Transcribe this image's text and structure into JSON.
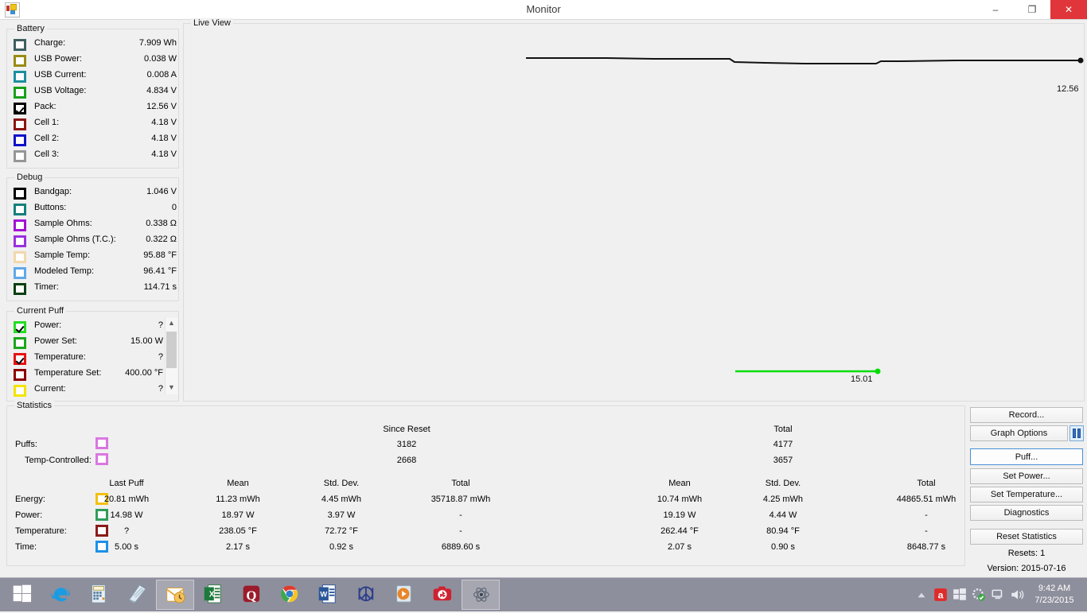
{
  "window": {
    "title": "Monitor",
    "icon": "app-icon",
    "minimize": "–",
    "maximize": "❐",
    "close": "✕"
  },
  "battery": {
    "legend": "Battery",
    "rows": [
      {
        "label": "Charge:",
        "value": "7.909 Wh",
        "color": "#3f5f5f",
        "checked": false
      },
      {
        "label": "USB Power:",
        "value": "0.038 W",
        "color": "#9a8b14",
        "checked": false
      },
      {
        "label": "USB Current:",
        "value": "0.008 A",
        "color": "#1d8f9e",
        "checked": false
      },
      {
        "label": "USB Voltage:",
        "value": "4.834 V",
        "color": "#19a019",
        "checked": false
      },
      {
        "label": "Pack:",
        "value": "12.56 V",
        "color": "#000000",
        "checked": true
      },
      {
        "label": "Cell 1:",
        "value": "4.18 V",
        "color": "#8c1414",
        "checked": false
      },
      {
        "label": "Cell 2:",
        "value": "4.18 V",
        "color": "#0f13c8",
        "checked": false
      },
      {
        "label": "Cell 3:",
        "value": "4.18 V",
        "color": "#969696",
        "checked": false
      }
    ]
  },
  "debug": {
    "legend": "Debug",
    "rows": [
      {
        "label": "Bandgap:",
        "value": "1.046 V",
        "color": "#000000",
        "checked": false
      },
      {
        "label": "Buttons:",
        "value": "0",
        "color": "#167f7f",
        "checked": false
      },
      {
        "label": "Sample Ohms:",
        "value": "0.338 Ω",
        "color": "#a211d6",
        "checked": false
      },
      {
        "label": "Sample Ohms (T.C.):",
        "value": "0.322 Ω",
        "color": "#9b30e0",
        "checked": false
      },
      {
        "label": "Sample Temp:",
        "value": "95.88 °F",
        "color": "#f2d8ac",
        "checked": false
      },
      {
        "label": "Modeled Temp:",
        "value": "96.41 °F",
        "color": "#5fa9e8",
        "checked": false
      },
      {
        "label": "Timer:",
        "value": "114.71 s",
        "color": "#0b4012",
        "checked": false
      }
    ]
  },
  "current_puff": {
    "legend": "Current Puff",
    "rows": [
      {
        "label": "Power:",
        "value": "?",
        "color": "#22dd22",
        "checked": true
      },
      {
        "label": "Power Set:",
        "value": "15.00 W",
        "color": "#1aa81a",
        "checked": false
      },
      {
        "label": "Temperature:",
        "value": "?",
        "color": "#e71212",
        "checked": true
      },
      {
        "label": "Temperature Set:",
        "value": "400.00 °F",
        "color": "#8c0000",
        "checked": false
      },
      {
        "label": "Current:",
        "value": "?",
        "color": "#f2e400",
        "checked": false
      }
    ],
    "scroll_up": "▲",
    "scroll_down": "▼"
  },
  "live_view": {
    "legend": "Live View",
    "series": [
      {
        "name": "Pack",
        "color": "#111111",
        "end_label": "12.56"
      },
      {
        "name": "Power Set",
        "color": "#00dd00",
        "end_label": "15.01"
      }
    ]
  },
  "chart_data": {
    "type": "line",
    "title": "Live View",
    "xlabel": "",
    "ylabel": "",
    "grid": false,
    "legend": "none",
    "series": [
      {
        "name": "Pack Voltage",
        "color": "#111111",
        "unit": "V",
        "end_value": 12.56,
        "end_label": "12.56",
        "points": [
          [
            660,
            72
          ],
          [
            700,
            72
          ],
          [
            760,
            72
          ],
          [
            820,
            73
          ],
          [
            880,
            73
          ],
          [
            916,
            73
          ],
          [
            922,
            77
          ],
          [
            960,
            78
          ],
          [
            1010,
            79
          ],
          [
            1060,
            79
          ],
          [
            1100,
            79
          ],
          [
            1106,
            76
          ],
          [
            1130,
            76
          ],
          [
            1200,
            75
          ],
          [
            1280,
            75
          ],
          [
            1340,
            75
          ],
          [
            1357,
            75
          ]
        ]
      },
      {
        "name": "Power Set",
        "color": "#00dd00",
        "unit": "W",
        "end_value": 15.01,
        "end_label": "15.01",
        "points": [
          [
            923,
            466
          ],
          [
            1000,
            466
          ],
          [
            1060,
            466
          ],
          [
            1102,
            466
          ]
        ]
      }
    ]
  },
  "statistics": {
    "legend": "Statistics",
    "puffs": {
      "label": "Puffs:",
      "sub_label": "Temp-Controlled:",
      "swatch": "#d977e0",
      "since_reset_header": "Since Reset",
      "total_header": "Total",
      "since_reset": "3182",
      "since_reset_tc": "2668",
      "total": "4177",
      "total_tc": "3657"
    },
    "columns_left": [
      "Last Puff",
      "Mean",
      "Std. Dev.",
      "Total"
    ],
    "columns_right": [
      "Mean",
      "Std. Dev.",
      "Total"
    ],
    "rows": [
      {
        "label": "Energy:",
        "swatch": "#f2c014",
        "last_puff": "20.81 mWh",
        "left": [
          "11.23 mWh",
          "4.45 mWh",
          "35718.87 mWh"
        ],
        "right": [
          "10.74 mWh",
          "4.25 mWh",
          "44865.51 mWh"
        ]
      },
      {
        "label": "Power:",
        "swatch": "#2f9e5a",
        "last_puff": "14.98 W",
        "left": [
          "18.97 W",
          "3.97 W",
          "-"
        ],
        "right": [
          "19.19 W",
          "4.44 W",
          "-"
        ]
      },
      {
        "label": "Temperature:",
        "swatch": "#8c1a1a",
        "last_puff": "?",
        "left": [
          "238.05 °F",
          "72.72 °F",
          "-"
        ],
        "right": [
          "262.44 °F",
          "80.94 °F",
          "-"
        ]
      },
      {
        "label": "Time:",
        "swatch": "#1e90e8",
        "last_puff": "5.00 s",
        "left": [
          "2.17 s",
          "0.92 s",
          "6889.60 s"
        ],
        "right": [
          "2.07 s",
          "0.90 s",
          "8648.77 s"
        ]
      }
    ]
  },
  "actions": {
    "record": "Record...",
    "graph_options": "Graph Options",
    "graph_options_icon": "pause-icon",
    "puff": "Puff...",
    "set_power": "Set Power...",
    "set_temperature": "Set Temperature...",
    "diagnostics": "Diagnostics",
    "reset_statistics": "Reset Statistics",
    "resets": "Resets: 1",
    "version": "Version: 2015-07-16"
  },
  "taskbar": {
    "items": [
      {
        "name": "start-button",
        "icon": "windows-logo-icon"
      },
      {
        "name": "internet-explorer",
        "icon": "ie-icon"
      },
      {
        "name": "calculator",
        "icon": "calculator-icon"
      },
      {
        "name": "notepad",
        "icon": "notepad-icon"
      },
      {
        "name": "outlook",
        "icon": "outlook-icon",
        "active": true
      },
      {
        "name": "excel",
        "icon": "excel-icon"
      },
      {
        "name": "quicken",
        "icon": "quicken-icon"
      },
      {
        "name": "chrome",
        "icon": "chrome-icon"
      },
      {
        "name": "word",
        "icon": "word-icon"
      },
      {
        "name": "peace-app",
        "icon": "peace-icon"
      },
      {
        "name": "media-player",
        "icon": "media-player-icon"
      },
      {
        "name": "camera-app",
        "icon": "camera-icon"
      },
      {
        "name": "monitor-app",
        "icon": "atom-icon",
        "active": true
      }
    ],
    "tray": [
      {
        "name": "show-hidden-icons",
        "icon": "chevron-up-icon"
      },
      {
        "name": "avast-antivirus",
        "icon": "avast-icon"
      },
      {
        "name": "windows-icon",
        "icon": "windows-tray-icon"
      },
      {
        "name": "settings-tray",
        "icon": "gear-tray-icon"
      },
      {
        "name": "network",
        "icon": "network-icon"
      },
      {
        "name": "volume",
        "icon": "speaker-icon"
      }
    ],
    "clock": {
      "time": "9:42 AM",
      "date": "7/23/2015"
    }
  }
}
